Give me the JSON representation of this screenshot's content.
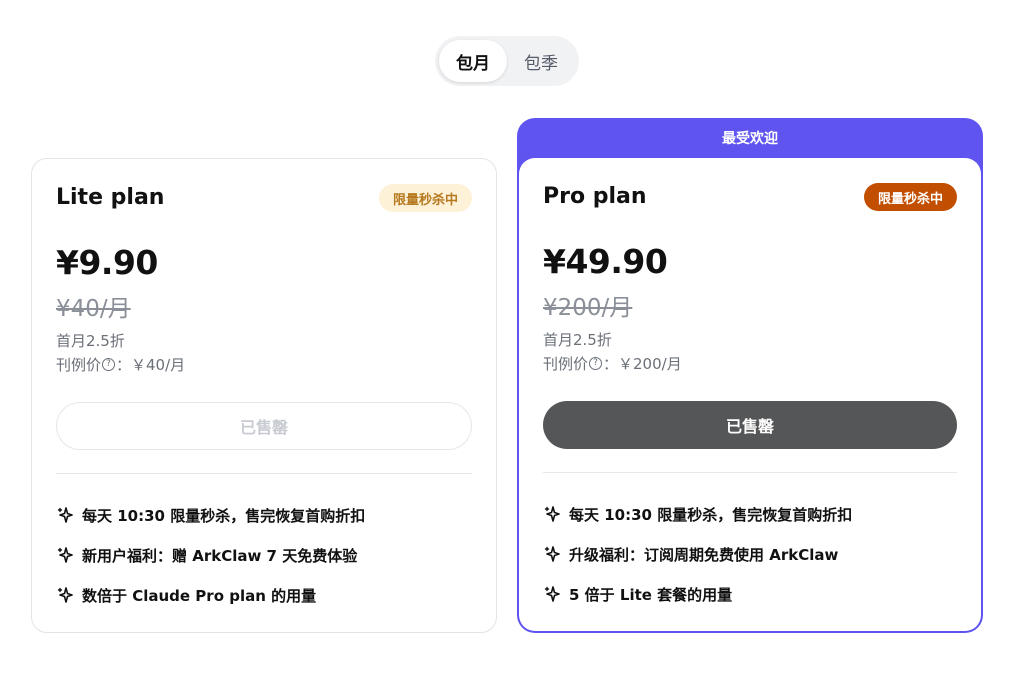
{
  "billing_toggle": {
    "options": [
      "包月",
      "包季"
    ],
    "selected": "包月"
  },
  "plans": [
    {
      "title": "Lite plan",
      "badge": "限量秒杀中",
      "price": "¥9.90",
      "original_price": "¥40/月",
      "discount_note": "首月2.5折",
      "reference_label": "刊例价",
      "reference_value": "：￥40/月",
      "cta_label": "已售罄",
      "features": [
        "每天 10:30 限量秒杀，售完恢复首购折扣",
        "新用户福利：赠 ArkClaw 7 天免费体验",
        "数倍于 Claude Pro plan 的用量"
      ]
    },
    {
      "ribbon": "最受欢迎",
      "title": "Pro plan",
      "badge": "限量秒杀中",
      "price": "¥49.90",
      "original_price": "¥200/月",
      "discount_note": "首月2.5折",
      "reference_label": "刊例价",
      "reference_value": "：￥200/月",
      "cta_label": "已售罄",
      "features": [
        "每天 10:30 限量秒杀，售完恢复首购折扣",
        "升级福利：订阅周期免费使用 ArkClaw",
        "5 倍于 Lite 套餐的用量"
      ]
    }
  ],
  "colors": {
    "accent": "#5f54f0",
    "badge_soft_bg": "#fdf1d8",
    "badge_soft_text": "#b7791f",
    "badge_solid_bg": "#c24e00",
    "sold_out_button": "#555658"
  },
  "icons": {
    "feature": "sparkle-icon",
    "reference_help": "help-icon"
  }
}
